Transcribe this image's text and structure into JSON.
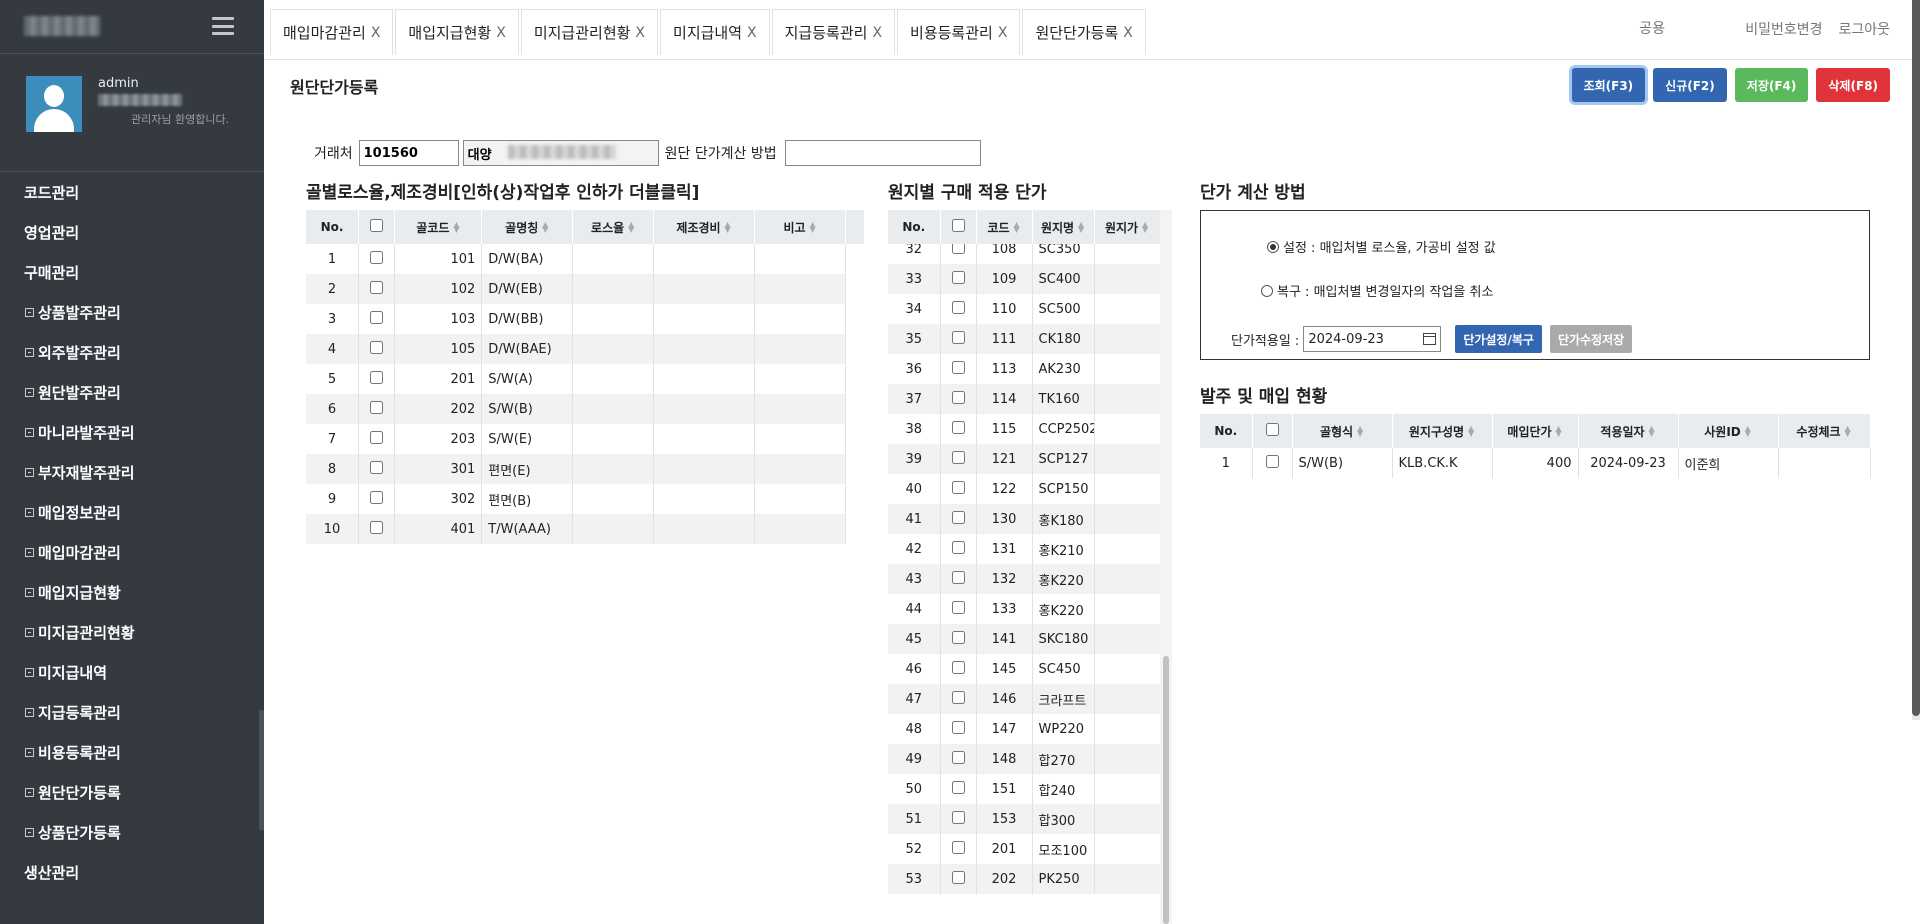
{
  "sidebar": {
    "user_name": "admin",
    "welcome": "관리자님 환영합니다.",
    "items": [
      {
        "label": "코드관리",
        "sub": false
      },
      {
        "label": "영업관리",
        "sub": false
      },
      {
        "label": "구매관리",
        "sub": false
      },
      {
        "label": "상품발주관리",
        "sub": true
      },
      {
        "label": "외주발주관리",
        "sub": true
      },
      {
        "label": "원단발주관리",
        "sub": true
      },
      {
        "label": "마니라발주관리",
        "sub": true
      },
      {
        "label": "부자재발주관리",
        "sub": true
      },
      {
        "label": "매입정보관리",
        "sub": true
      },
      {
        "label": "매입마감관리",
        "sub": true
      },
      {
        "label": "매입지급현황",
        "sub": true
      },
      {
        "label": "미지급관리현황",
        "sub": true
      },
      {
        "label": "미지급내역",
        "sub": true
      },
      {
        "label": "지급등록관리",
        "sub": true
      },
      {
        "label": "비용등록관리",
        "sub": true
      },
      {
        "label": "원단단가등록",
        "sub": true
      },
      {
        "label": "상품단가등록",
        "sub": true
      },
      {
        "label": "생산관리",
        "sub": false
      }
    ]
  },
  "tabs": [
    {
      "label": "매입마감관리",
      "close": "X"
    },
    {
      "label": "매입지급현황",
      "close": "X"
    },
    {
      "label": "미지급관리현황",
      "close": "X"
    },
    {
      "label": "미지급내역",
      "close": "X"
    },
    {
      "label": "지급등록관리",
      "close": "X"
    },
    {
      "label": "비용등록관리",
      "close": "X"
    },
    {
      "label": "원단단가등록",
      "close": "X"
    }
  ],
  "top": {
    "search_placeholder": "공용",
    "change_password": "비밀번호변경",
    "logout": "로그아웃"
  },
  "page": {
    "title": "원단단가등록",
    "buttons": {
      "search": "조회(F3)",
      "new": "신규(F2)",
      "save": "저장(F4)",
      "delete": "삭제(F8)"
    }
  },
  "form": {
    "vendor_label": "거래처",
    "vendor_code": "101560",
    "vendor_name": "대양",
    "method_label": "원단 단가계산 방법",
    "method_value": ""
  },
  "grid1": {
    "title": "골별로스율,제조경비[인하(상)작업후 인하가 더블클릭]",
    "headers": [
      "No.",
      "",
      "골코드",
      "골명칭",
      "로스율",
      "제조경비",
      "비고"
    ],
    "rows": [
      {
        "no": "1",
        "code": "101",
        "name": "D/W(BA)"
      },
      {
        "no": "2",
        "code": "102",
        "name": "D/W(EB)"
      },
      {
        "no": "3",
        "code": "103",
        "name": "D/W(BB)"
      },
      {
        "no": "4",
        "code": "105",
        "name": "D/W(BAE)"
      },
      {
        "no": "5",
        "code": "201",
        "name": "S/W(A)"
      },
      {
        "no": "6",
        "code": "202",
        "name": "S/W(B)"
      },
      {
        "no": "7",
        "code": "203",
        "name": "S/W(E)"
      },
      {
        "no": "8",
        "code": "301",
        "name": "편면(E)"
      },
      {
        "no": "9",
        "code": "302",
        "name": "편면(B)"
      },
      {
        "no": "10",
        "code": "401",
        "name": "T/W(AAA)"
      }
    ]
  },
  "grid2": {
    "title": "원지별 구매 적용 단가",
    "headers": [
      "No.",
      "",
      "코드",
      "원지명",
      "원지가"
    ],
    "rows": [
      {
        "no": "32",
        "code": "108",
        "name": "SC350"
      },
      {
        "no": "33",
        "code": "109",
        "name": "SC400"
      },
      {
        "no": "34",
        "code": "110",
        "name": "SC500"
      },
      {
        "no": "35",
        "code": "111",
        "name": "CK180"
      },
      {
        "no": "36",
        "code": "113",
        "name": "AK230"
      },
      {
        "no": "37",
        "code": "114",
        "name": "TK160"
      },
      {
        "no": "38",
        "code": "115",
        "name": "CCP2502"
      },
      {
        "no": "39",
        "code": "121",
        "name": "SCP127"
      },
      {
        "no": "40",
        "code": "122",
        "name": "SCP150"
      },
      {
        "no": "41",
        "code": "130",
        "name": "홍K180"
      },
      {
        "no": "42",
        "code": "131",
        "name": "홍K210"
      },
      {
        "no": "43",
        "code": "132",
        "name": "홍K220"
      },
      {
        "no": "44",
        "code": "133",
        "name": "홍K220"
      },
      {
        "no": "45",
        "code": "141",
        "name": "SKC180"
      },
      {
        "no": "46",
        "code": "145",
        "name": "SC450"
      },
      {
        "no": "47",
        "code": "146",
        "name": "크라프트"
      },
      {
        "no": "48",
        "code": "147",
        "name": "WP220"
      },
      {
        "no": "49",
        "code": "148",
        "name": "합270"
      },
      {
        "no": "50",
        "code": "151",
        "name": "합240"
      },
      {
        "no": "51",
        "code": "153",
        "name": "합300"
      },
      {
        "no": "52",
        "code": "201",
        "name": "모조100"
      },
      {
        "no": "53",
        "code": "202",
        "name": "PK250"
      }
    ]
  },
  "method": {
    "title": "단가 계산 방법",
    "opt1": "설정 : 매입처별 로스율, 가공비 설정 값",
    "opt2": "복구 : 매입처별 변경일자의 작업을 취소",
    "date_label": "단가적용일 :",
    "date_value": "2024-09-23",
    "btn_set": "단가설정/복구",
    "btn_save": "단가수정저장"
  },
  "grid3": {
    "title": "발주 및 매입 현황",
    "headers": [
      "No.",
      "",
      "골형식",
      "원지구성명",
      "매입단가",
      "적용일자",
      "사원ID",
      "수정체크"
    ],
    "rows": [
      {
        "no": "1",
        "type": "S/W(B)",
        "comp": "KLB.CK.K",
        "price": "400",
        "date": "2024-09-23",
        "emp": "이준희"
      }
    ]
  }
}
